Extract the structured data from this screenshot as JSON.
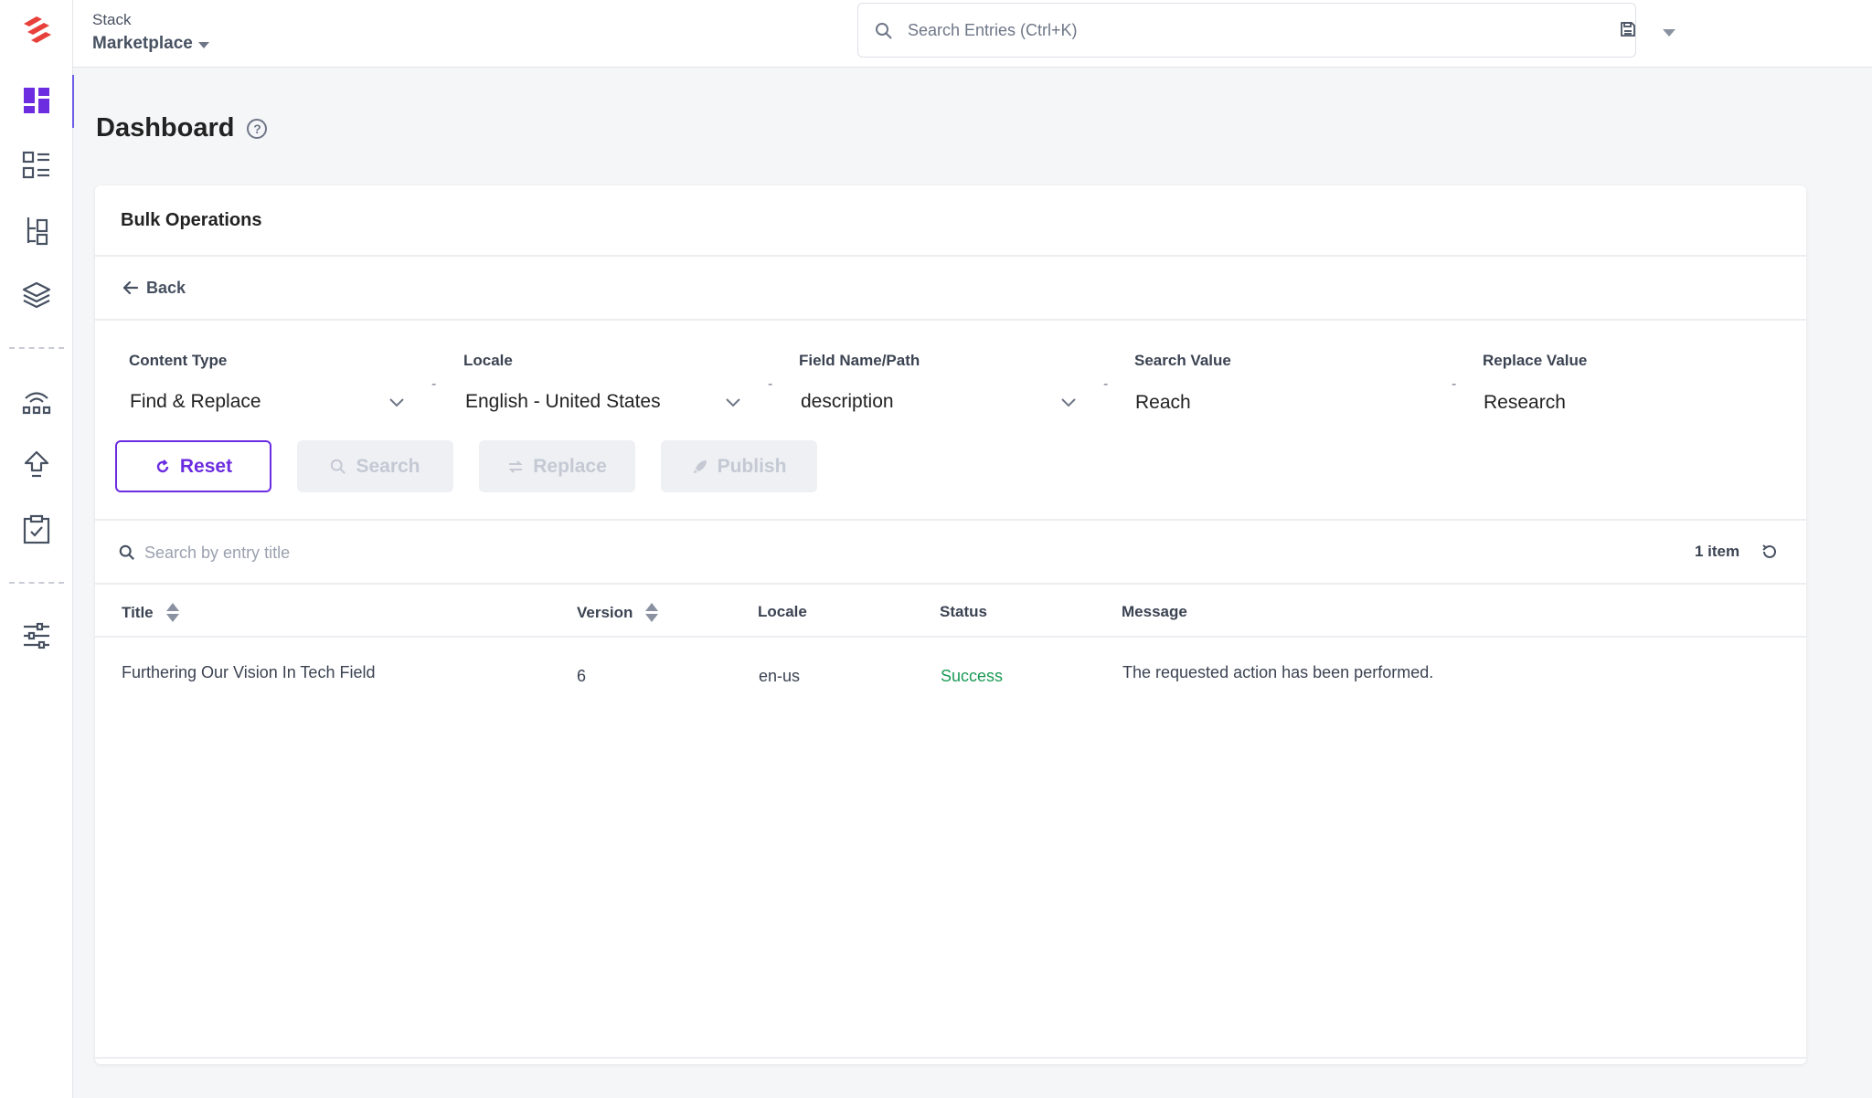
{
  "header": {
    "stack_label": "Stack",
    "stack_name": "Marketplace",
    "search_placeholder": "Search Entries (Ctrl+K)"
  },
  "sidebar": {
    "items": [
      {
        "name": "dashboard-icon",
        "active": true
      },
      {
        "name": "content-models-icon"
      },
      {
        "name": "entries-icon"
      },
      {
        "name": "assets-icon"
      },
      {
        "name": "releases-icon"
      },
      {
        "name": "publish-queue-icon"
      },
      {
        "name": "tasks-icon"
      },
      {
        "name": "settings-icon"
      }
    ]
  },
  "page": {
    "title": "Dashboard"
  },
  "card": {
    "title": "Bulk Operations",
    "back_label": "Back",
    "filters": {
      "content_type": {
        "label": "Content Type",
        "value": "Find & Replace"
      },
      "locale": {
        "label": "Locale",
        "value": "English - United States"
      },
      "field": {
        "label": "Field Name/Path",
        "value": "description"
      },
      "search_value": {
        "label": "Search Value",
        "value": "Reach"
      },
      "replace_value": {
        "label": "Replace Value",
        "value": "Research"
      },
      "separator": "-"
    },
    "buttons": {
      "reset": "Reset",
      "search": "Search",
      "replace": "Replace",
      "publish": "Publish"
    },
    "entry_search_placeholder": "Search by entry title",
    "item_count": "1 item",
    "table": {
      "columns": [
        "Title",
        "Version",
        "Locale",
        "Status",
        "Message"
      ],
      "rows": [
        {
          "title": "Furthering Our Vision In Tech Field",
          "version": "6",
          "locale": "en-us",
          "status": "Success",
          "message": "The requested action has been performed."
        }
      ]
    }
  },
  "colors": {
    "accent": "#6c2ce0",
    "success": "#1a9a55",
    "brand": "#e8403a"
  }
}
